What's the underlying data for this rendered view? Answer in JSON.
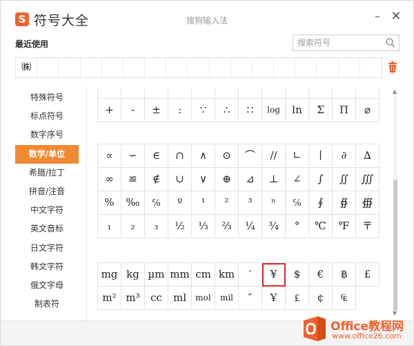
{
  "window": {
    "logo_glyph": "S",
    "title": "符号大全",
    "center_title": "搜狗输入法"
  },
  "controls": {
    "minimize": "–",
    "close": "✕"
  },
  "recent": {
    "label": "最近使用",
    "items": [
      "㈱",
      "",
      "",
      "",
      "",
      "",
      "",
      "",
      "",
      "",
      "",
      "",
      "",
      "",
      "",
      "",
      ""
    ]
  },
  "search": {
    "placeholder": "搜索符号"
  },
  "sidebar": {
    "items": [
      {
        "label": "特殊符号",
        "active": false
      },
      {
        "label": "标点符号",
        "active": false
      },
      {
        "label": "数字序号",
        "active": false
      },
      {
        "label": "数学/单位",
        "active": true
      },
      {
        "label": "希腊/拉丁",
        "active": false
      },
      {
        "label": "拼音/注音",
        "active": false
      },
      {
        "label": "中文字符",
        "active": false
      },
      {
        "label": "英文音标",
        "active": false
      },
      {
        "label": "日文字符",
        "active": false
      },
      {
        "label": "韩文字符",
        "active": false
      },
      {
        "label": "俄文字母",
        "active": false
      },
      {
        "label": "制表符",
        "active": false
      }
    ]
  },
  "symbols": {
    "top_partial": [
      [
        "",
        "",
        "",
        "",
        "",
        "",
        "",
        "",
        "",
        "",
        "",
        ""
      ],
      [
        "+",
        "-",
        "±",
        ":",
        "∵",
        "∴",
        "∷",
        "log",
        "ln",
        "Σ",
        "Π",
        "⌀"
      ]
    ],
    "math_rows": [
      [
        "∝",
        "∽",
        "∈",
        "∩",
        "∧",
        "⊙",
        "⌒",
        "//",
        "∟",
        "∣",
        "∂",
        "∆"
      ],
      [
        "∞",
        "≌",
        "∉",
        "∪",
        "∨",
        "⊕",
        "⊿",
        "⊥",
        "∠",
        "∫",
        "∬",
        "∭"
      ],
      [
        "%",
        "‰",
        "℅",
        "º",
        "¹",
        "²",
        "³",
        "ⁿ",
        "℅",
        "∮",
        "∯",
        "∰"
      ],
      [
        "₁",
        "₂",
        "₃",
        "½",
        "⅓",
        "⅔",
        "¼",
        "¾",
        "°",
        "℃",
        "℉",
        "〒"
      ]
    ],
    "unit_rows": [
      [
        "mg",
        "kg",
        "µm",
        "mm",
        "cm",
        "km",
        "′",
        "¥",
        "$",
        "€",
        "฿",
        "£"
      ],
      [
        "m²",
        "m³",
        "cc",
        "ml",
        "mol",
        "mil",
        "″",
        "Ұ",
        "₤",
        "¢",
        "₠",
        ""
      ]
    ],
    "selected": "¥"
  },
  "watermark": {
    "title": "Office教程网",
    "url": "www.office26.com"
  },
  "colors": {
    "accent": "#f08a32",
    "logo": "#f0622d",
    "selection": "#d42a2a"
  }
}
